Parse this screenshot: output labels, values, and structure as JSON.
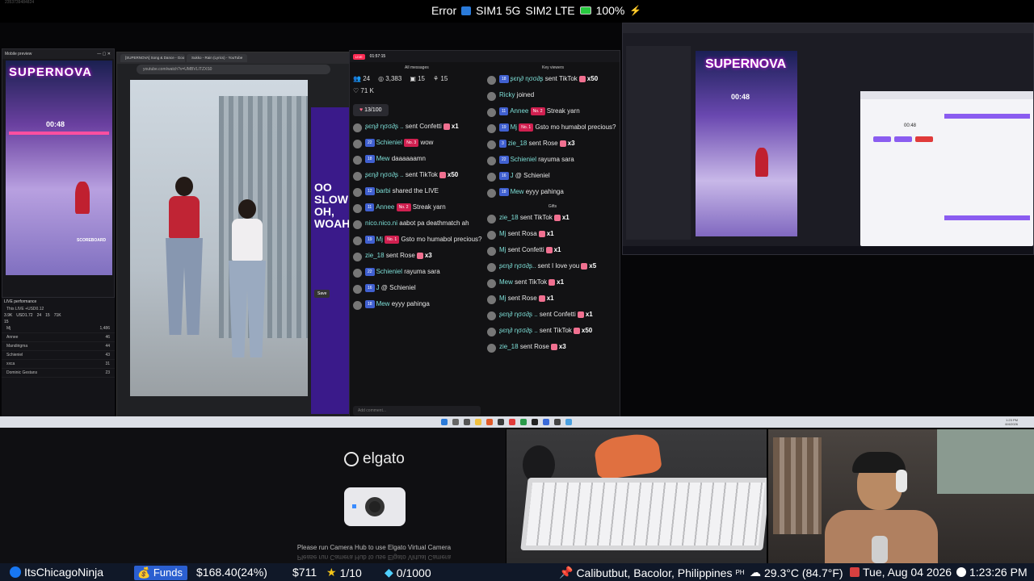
{
  "status": {
    "id_text": "2353739484824",
    "error": "Error",
    "sim1": "SIM1 5G",
    "sim2": "SIM2 LTE",
    "battery": "100%"
  },
  "mobile_preview": {
    "title": "Mobile preview",
    "logo": "SUPERNOVA",
    "subtitle": "BEFORE THE COSMOS",
    "timer": "00:48",
    "scoreboard": "SCOREBOARD"
  },
  "live_performance": {
    "title": "LIVE performance",
    "subtitle": "This LIVE +USD0.12",
    "stats": [
      "3.9K",
      "USD1.72",
      "24",
      "15",
      "71K"
    ],
    "count": "15",
    "rows": [
      {
        "name": "Mj",
        "value": "1,486"
      },
      {
        "name": "Annee",
        "value": "46"
      },
      {
        "name": "Mandirigma",
        "value": "44"
      },
      {
        "name": "Schieniel",
        "value": "43"
      },
      {
        "name": "xxca",
        "value": "31"
      },
      {
        "name": "Dominic Gestans",
        "value": "23"
      }
    ]
  },
  "browser": {
    "tabs": [
      "[SUPERNOVA] Song & Dance - Goo",
      "Sukko - Rain (Lyrics) - YouTube"
    ],
    "url": "youtube.com/watch?v=UMBVLITZXS0",
    "side_text": "OO SLOW OH, WOAH",
    "save_label": "Save"
  },
  "chat": {
    "live_label": "LIVE",
    "time": "01:57:15",
    "all_messages": "All messages",
    "key_viewers": "Key viewers",
    "viewers": "24",
    "views": "3,383",
    "gifters": "15",
    "members": "15",
    "likes": "71 K",
    "goal": "13/100",
    "input_placeholder": "Add comment...",
    "gifts_label": "Gifts",
    "left_messages": [
      {
        "name": "ʂєɳ∂ ɳσσ∂ʂ ..",
        "text": "sent Confetti",
        "mult": "x1"
      },
      {
        "name": "Schieniel",
        "badge": "22",
        "rank": "No. 3",
        "text": "wow"
      },
      {
        "name": "Mew",
        "badge": "18",
        "text": "daaaaaamn"
      },
      {
        "name": "ʂєɳ∂ ɳσσ∂ʂ ..",
        "text": "sent TikTok",
        "mult": "x50"
      },
      {
        "name": "barbi",
        "badge": "12",
        "text": "shared the LIVE"
      },
      {
        "name": "Annee",
        "badge": "11",
        "rank": "No. 2",
        "text": "Streak yarn"
      },
      {
        "name": "nico.nico.ni",
        "text": "aabot pa deathmatch ah"
      },
      {
        "name": "Mj",
        "badge": "19",
        "rank": "No. 1",
        "text": "Gsto mo humabol precious?"
      },
      {
        "name": "zie_18",
        "text": "sent Rose",
        "mult": "x3"
      },
      {
        "name": "Schieniel",
        "badge": "22",
        "text": "rayuma sara"
      },
      {
        "name": "J",
        "badge": "16",
        "text": "@ Schieniel"
      },
      {
        "name": "Mew",
        "badge": "18",
        "text": "eyyy pahinga"
      }
    ],
    "key_messages": [
      {
        "name": "ʂєɳ∂ ɳσσ∂ʂ",
        "badge": "18",
        "text": "sent TikTok",
        "mult": "x50"
      },
      {
        "name": "Ricky",
        "text": "joined"
      },
      {
        "name": "Annee",
        "badge": "11",
        "rank": "No. 2",
        "text": "Streak yarn"
      },
      {
        "name": "Mj",
        "badge": "19",
        "rank": "No. 1",
        "text": "Gsto mo humabol precious?"
      },
      {
        "name": "zie_18",
        "badge": "3",
        "text": "sent Rose",
        "mult": "x3"
      },
      {
        "name": "Schieniel",
        "badge": "22",
        "text": "rayuma sara"
      },
      {
        "name": "J",
        "badge": "16",
        "text": "@ Schieniel"
      },
      {
        "name": "Mew",
        "badge": "18",
        "text": "eyyy pahinga"
      }
    ],
    "gifts": [
      {
        "name": "zie_18",
        "text": "sent TikTok",
        "mult": "x1"
      },
      {
        "name": "Mj",
        "text": "sent Rosa",
        "mult": "x1"
      },
      {
        "name": "Mj",
        "text": "sent Confetti",
        "mult": "x1"
      },
      {
        "name": "ʂєɳ∂ ɳσσ∂ʂ..",
        "text": "sent I love you",
        "mult": "x5"
      },
      {
        "name": "Mew",
        "text": "sent TikTok",
        "mult": "x1"
      },
      {
        "name": "Mj",
        "text": "sent Rose",
        "mult": "x1"
      },
      {
        "name": "ʂєɳ∂ ɳσσ∂ʂ ..",
        "text": "sent Confetti",
        "mult": "x1"
      },
      {
        "name": "ʂєɳ∂ ɳσσ∂ʂ ..",
        "text": "sent TikTok",
        "mult": "x50"
      },
      {
        "name": "zie_18",
        "text": "sent Rose",
        "mult": "x3"
      }
    ]
  },
  "right_window": {
    "logo": "SUPERNOVA",
    "timer": "00:48",
    "panel_timer": "00:48"
  },
  "taskbar": {
    "time": "1:23 PM",
    "date": "8/4/2026"
  },
  "elgato": {
    "logo": "elgato",
    "message": "Please run Camera Hub to use Elgato Virtual Camera",
    "message_mirror": "Please run Camera Hub to use Elgato Virtual Camera"
  },
  "ticker": {
    "handle": "ItsChicagoNinja",
    "funds_label": "Funds",
    "funds_value": "$168.40(24%)",
    "amount": "$711",
    "stars": "1/10",
    "gems": "0/1000",
    "location": "Calibutbut, Bacolor, Philippines",
    "country": "PH",
    "weather": "29.3°C (84.7°F)",
    "date": "Tue, Aug 04 2026",
    "time": "1:23:26 PM"
  },
  "colors": {
    "accent_pink": "#ff2b54",
    "teal_name": "#7ee0d8",
    "badge_blue": "#4060d0",
    "funds_blue": "#2b5fd0"
  }
}
